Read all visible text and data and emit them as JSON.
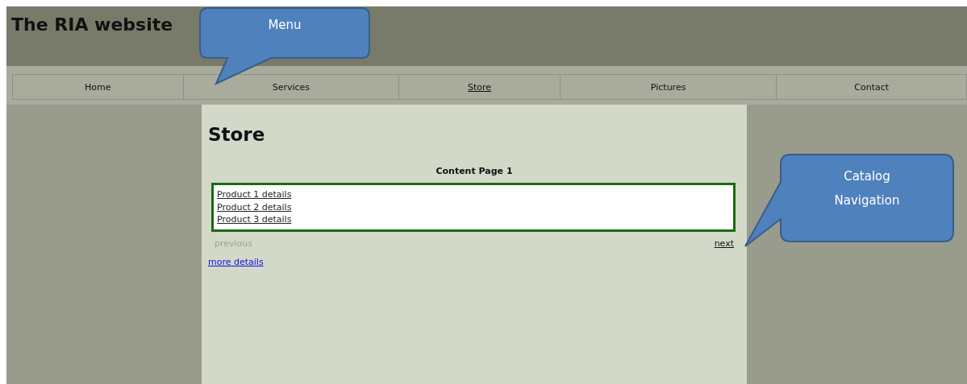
{
  "site_title": "The RIA website",
  "nav": [
    {
      "label": "Home",
      "selected": false
    },
    {
      "label": "Services",
      "selected": false
    },
    {
      "label": "Store",
      "selected": true
    },
    {
      "label": "Pictures",
      "selected": false
    },
    {
      "label": "Contact",
      "selected": false
    }
  ],
  "heading": "Store",
  "content_title": "Content Page 1",
  "products": [
    "Product 1 details",
    "Product 2 details",
    "Product 3 details"
  ],
  "pager": [
    {
      "label": "previous",
      "disabled": true
    },
    {
      "label": "next",
      "disabled": false
    }
  ],
  "more_link": "more details",
  "callouts": [
    {
      "kind": "top",
      "text": "Menu"
    },
    {
      "kind": "right",
      "text": "Catalog Navigation"
    }
  ]
}
